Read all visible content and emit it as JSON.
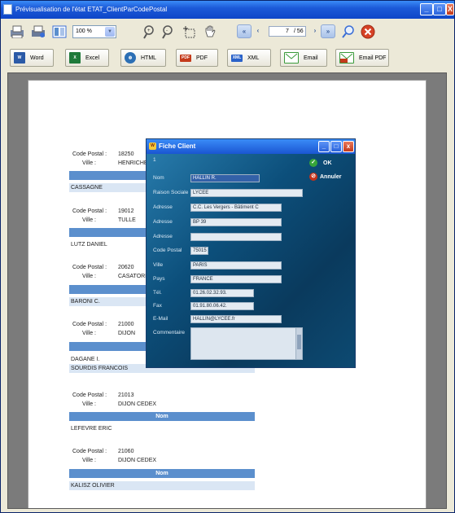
{
  "window": {
    "title": "Prévisualisation de l'état ETAT_ClientParCodePostal"
  },
  "toolbar": {
    "zoom": "100 %",
    "page_current": "7",
    "page_total": "/ 56",
    "export": [
      {
        "label": "Word",
        "icon": "word-icon",
        "color": "#2b5aa7"
      },
      {
        "label": "Excel",
        "icon": "excel-icon",
        "color": "#1f7a3a"
      },
      {
        "label": "HTML",
        "icon": "html-globe-icon",
        "color": "#2c6fb5"
      },
      {
        "label": "PDF",
        "icon": "pdf-icon",
        "color": "#c43a1b"
      },
      {
        "label": "XML",
        "icon": "xml-icon",
        "color": "#2a62c9"
      },
      {
        "label": "Email",
        "icon": "email-icon",
        "color": "#3a9a3a"
      },
      {
        "label": "Email PDF",
        "icon": "email-pdf-icon",
        "color": "#c43a1b"
      }
    ]
  },
  "report": {
    "code_postal_label": "Code Postal :",
    "ville_label": "Ville :",
    "nom_header": "Nom",
    "groups": [
      {
        "code": "18250",
        "ville": "HENRICHE",
        "names": [
          "CASSAGNE"
        ]
      },
      {
        "code": "19012",
        "ville": "TULLE",
        "names": [
          "LUTZ DANIEL"
        ]
      },
      {
        "code": "20620",
        "ville": "CASATORR",
        "names": [
          "BARONI C."
        ]
      },
      {
        "code": "21000",
        "ville": "DIJON",
        "names": [
          "DAGANE I.",
          "SOURDIS FRANCOIS"
        ]
      },
      {
        "code": "21013",
        "ville": "DIJON CEDEX",
        "names": [
          "LEFEVRE ERIC"
        ]
      },
      {
        "code": "21060",
        "ville": "DIJON CEDEX",
        "names": [
          "KALISZ OLIVIER"
        ]
      }
    ]
  },
  "dialog": {
    "title": "Fiche Client",
    "record_number": "1",
    "ok_label": "OK",
    "cancel_label": "Annuler",
    "fields": [
      {
        "label": "Nom",
        "value": "HALLIN R."
      },
      {
        "label": "Raison Sociale",
        "value": "LYCEE"
      },
      {
        "label": "Adresse",
        "value": "C.C. Les Vergers - Bâtiment C"
      },
      {
        "label": "Adresse",
        "value": "BP 39"
      },
      {
        "label": "Adresse",
        "value": ""
      },
      {
        "label": "Code Postal",
        "value": "75015"
      },
      {
        "label": "Ville",
        "value": "PARIS"
      },
      {
        "label": "Pays",
        "value": "FRANCE"
      },
      {
        "label": "Tél.",
        "value": "01.26.02.32.93."
      },
      {
        "label": "Fax",
        "value": "01.91.80.06.42."
      },
      {
        "label": "E-Mail",
        "value": "HALLIN@LYCEE.fr"
      },
      {
        "label": "Commentaire",
        "value": ""
      }
    ]
  }
}
